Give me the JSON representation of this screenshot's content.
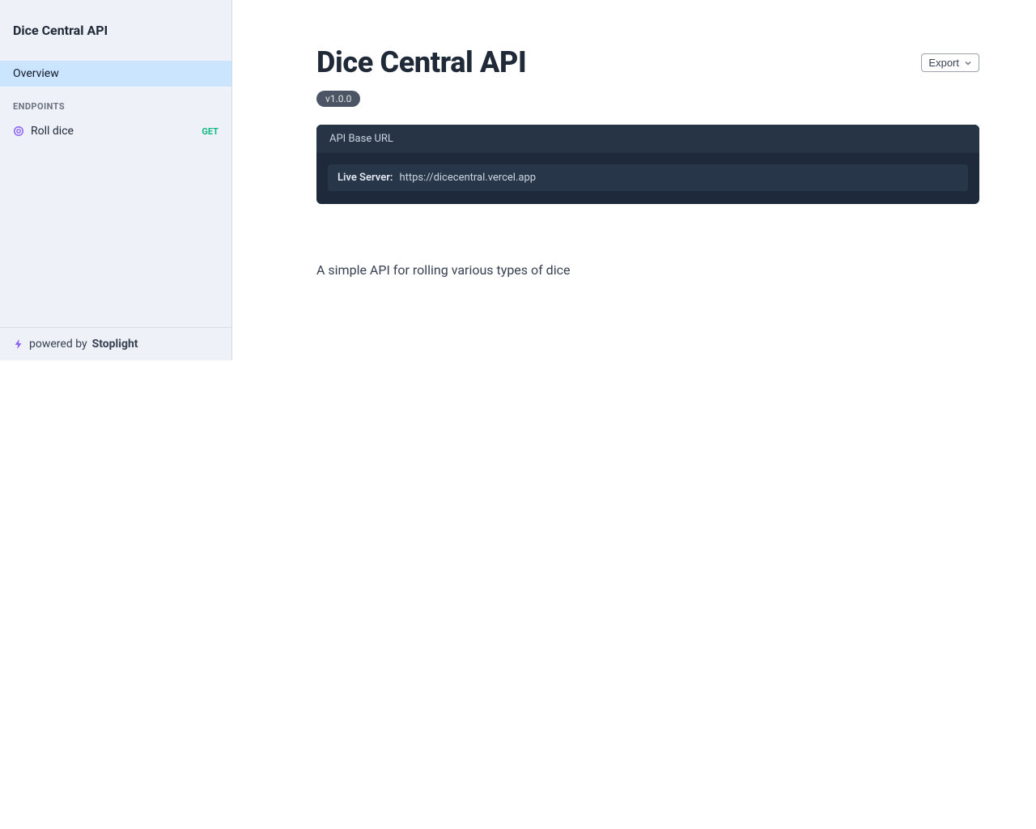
{
  "sidebar": {
    "title": "Dice Central API",
    "overview_label": "Overview",
    "endpoints_heading": "ENDPOINTS",
    "endpoints": [
      {
        "name": "Roll dice",
        "method": "GET"
      }
    ],
    "footer": {
      "prefix": "powered by ",
      "brand": "Stoplight"
    }
  },
  "main": {
    "title": "Dice Central API",
    "export_label": "Export",
    "version": "v1.0.0",
    "base_url_heading": "API Base URL",
    "server_label": "Live Server:",
    "server_url": "https://dicecentral.vercel.app",
    "description": "A simple API for rolling various types of dice"
  }
}
